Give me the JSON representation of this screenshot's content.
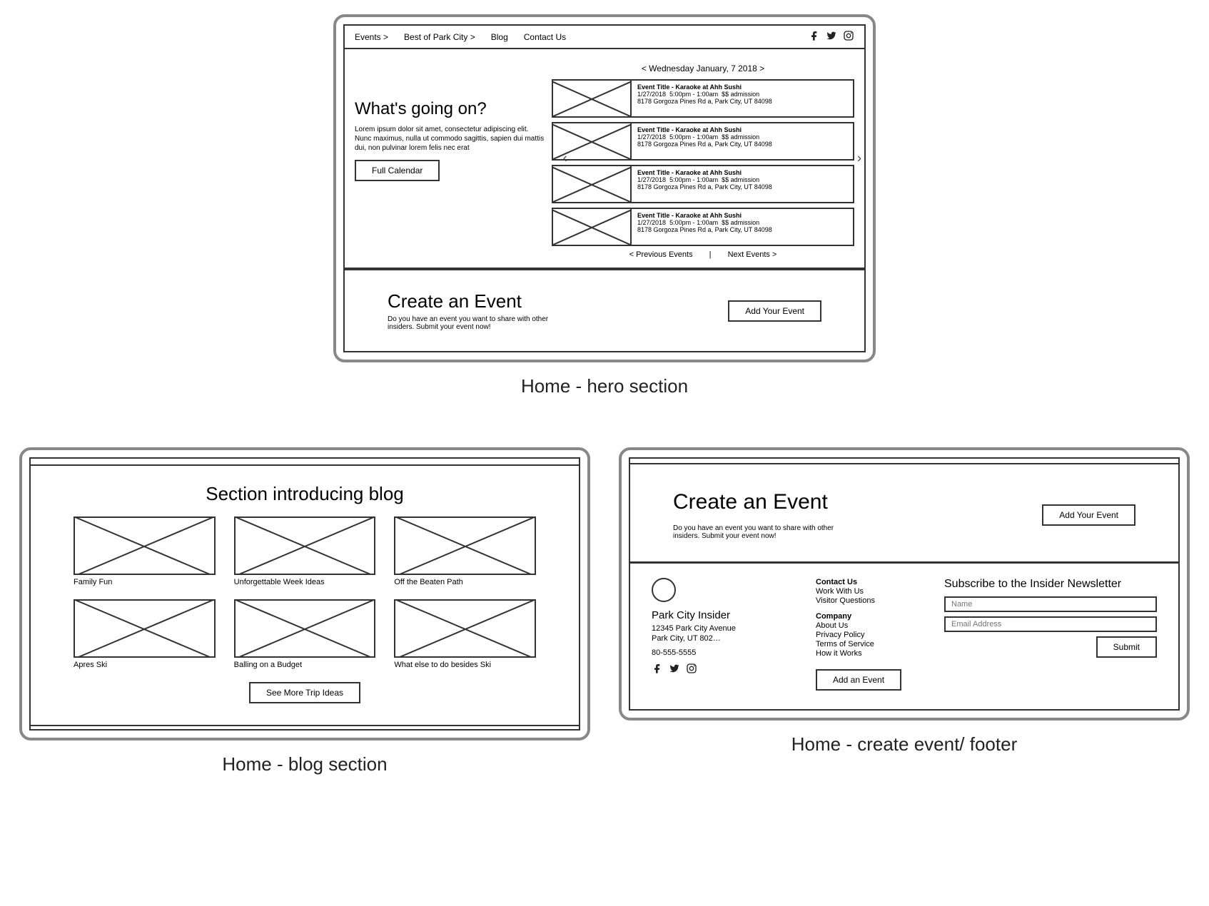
{
  "captions": {
    "hero": "Home - hero section",
    "blog": "Home - blog section",
    "footer": "Home - create event/ footer"
  },
  "nav": {
    "events": "Events >",
    "best": "Best of Park City >",
    "blog": "Blog",
    "contact": "Contact Us"
  },
  "hero": {
    "title": "What's going on?",
    "blurb": "Lorem ipsum dolor sit amet, consectetur adipiscing elit. Nunc maximus, nulla ut commodo sagittis, sapien dui mattis dui, non pulvinar lorem felis nec erat",
    "button": "Full Calendar",
    "date": "< Wednesday January, 7 2018 >",
    "prev": "< Previous Events",
    "sep": "|",
    "next": "Next Events >",
    "events": [
      {
        "title": "Event Title - Karaoke at Ahh Sushi",
        "date": "1/27/2018",
        "time": "5:00pm - 1:00am",
        "adm": "$$ admission",
        "addr": "8178 Gorgoza Pines Rd a, Park City, UT 84098"
      },
      {
        "title": "Event Title - Karaoke at Ahh Sushi",
        "date": "1/27/2018",
        "time": "5:00pm - 1:00am",
        "adm": "$$ admission",
        "addr": "8178 Gorgoza Pines Rd a, Park City, UT 84098"
      },
      {
        "title": "Event Title - Karaoke at Ahh Sushi",
        "date": "1/27/2018",
        "time": "5:00pm - 1:00am",
        "adm": "$$ admission",
        "addr": "8178 Gorgoza Pines Rd a, Park City, UT 84098"
      },
      {
        "title": "Event Title - Karaoke at Ahh Sushi",
        "date": "1/27/2018",
        "time": "5:00pm - 1:00am",
        "adm": "$$ admission",
        "addr": "8178 Gorgoza Pines Rd a, Park City, UT 84098"
      }
    ]
  },
  "cta": {
    "title": "Create an Event",
    "blurb": "Do you have an event you want to share with other insiders. Submit your event now!",
    "button": "Add Your Event"
  },
  "blog": {
    "title": "Section introducing blog",
    "cards": [
      "Family Fun",
      "Unforgettable Week Ideas",
      "Off the Beaten Path",
      "Apres Ski",
      "Balling on a Budget",
      "What else to do besides Ski"
    ],
    "button": "See More Trip Ideas"
  },
  "footer": {
    "brand": "Park City Insider",
    "addr1": "12345 Park City Avenue",
    "addr2": "Park City, UT 802…",
    "phone": "80-555-5555",
    "col2a_hd": "Contact Us",
    "col2a_1": "Work With Us",
    "col2a_2": "Visitor Questions",
    "col2b_hd": "Company",
    "col2b_1": "About Us",
    "col2b_2": "Privacy Policy",
    "col2b_3": "Terms of Service",
    "col2b_4": "How it Works",
    "addbtn": "Add an Event",
    "news_title": "Subscribe to the Insider Newsletter",
    "ph_name": "Name",
    "ph_email": "Email Address",
    "submit": "Submit"
  }
}
